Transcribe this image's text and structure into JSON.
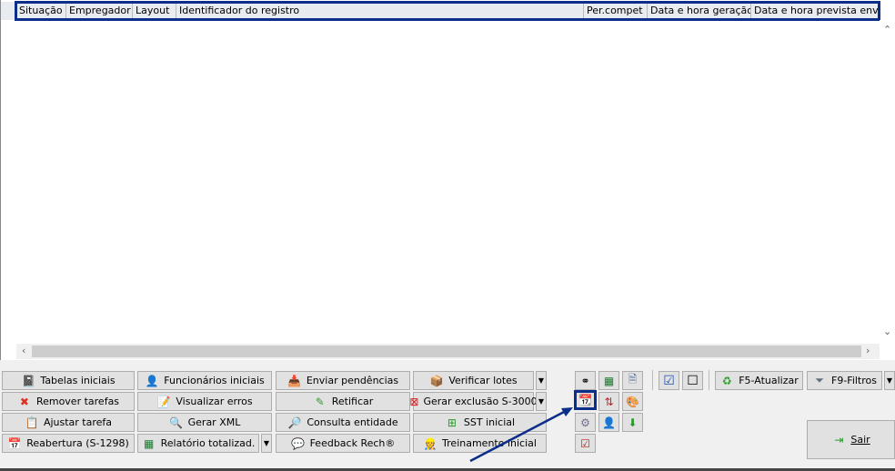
{
  "grid": {
    "columns": [
      "Situação",
      "Empregador",
      "Layout",
      "Identificador do registro",
      "Per.compet",
      "Data e hora geração",
      "Data e hora prevista envio"
    ]
  },
  "buttons": {
    "tabelas": "Tabelas iniciais",
    "funcionarios": "Funcionários iniciais",
    "enviar": "Enviar pendências",
    "verificar": "Verificar lotes",
    "remover": "Remover tarefas",
    "visualizar": "Visualizar erros",
    "retificar": "Retificar",
    "gerar_exclusao": "Gerar exclusão S-3000",
    "ajustar": "Ajustar tarefa",
    "gerar_xml": "Gerar XML",
    "consulta": "Consulta entidade",
    "sst": "SST inicial",
    "reabertura": "Reabertura (S-1298)",
    "relatorio": "Relatório totalizad.",
    "feedback": "Feedback Rech®",
    "treinamento": "Treinamento inicial",
    "atualizar": "F5-Atualizar",
    "filtros": "F9-Filtros",
    "sair": "Sair"
  },
  "colors": {
    "highlight": "#0a2e8a"
  }
}
